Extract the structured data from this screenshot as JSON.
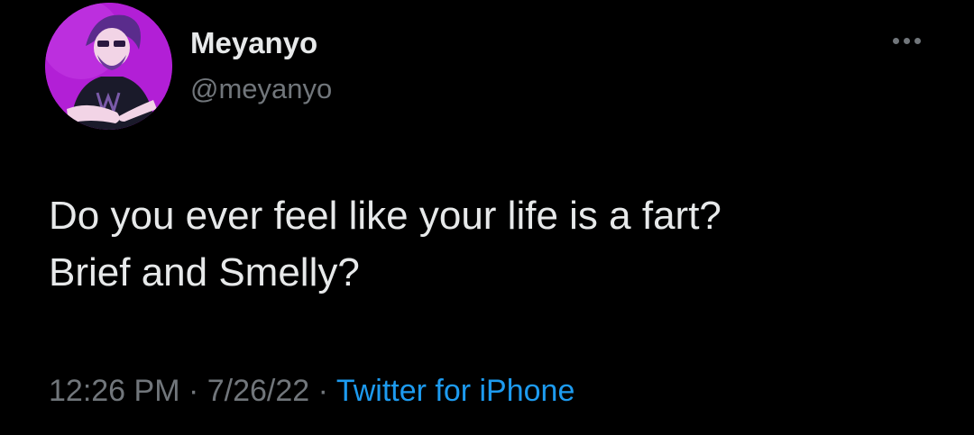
{
  "user": {
    "display_name": "Meyanyo",
    "handle": "@meyanyo",
    "avatar_icon": "profile-avatar-icon"
  },
  "tweet": {
    "text_lines": [
      "Do you ever feel like your life is a fart?",
      "Brief and Smelly?"
    ]
  },
  "meta": {
    "time": "12:26 PM",
    "separator": " · ",
    "date": "7/26/22",
    "source": "Twitter for iPhone"
  },
  "more_icon": "more-options-icon",
  "colors": {
    "background": "#000000",
    "primary_text": "#e7e9ea",
    "secondary_text": "#71767b",
    "link": "#1d9bf0",
    "avatar_background": "#b21fd6"
  }
}
